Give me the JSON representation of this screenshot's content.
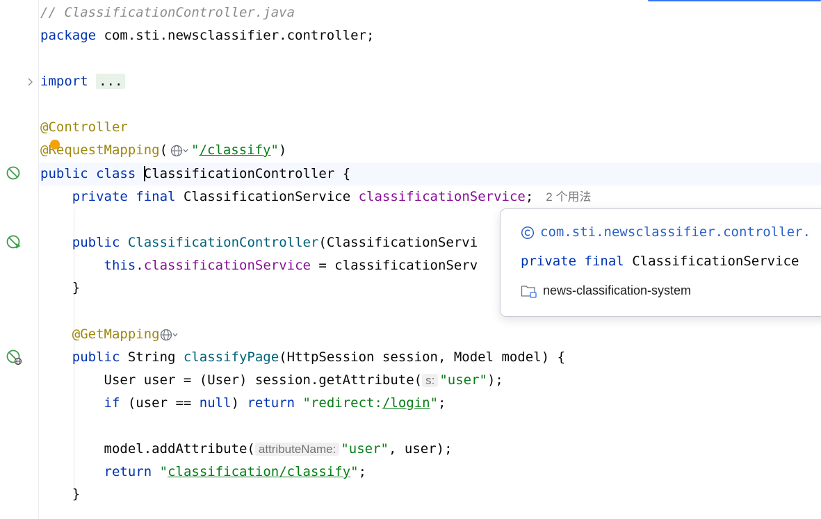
{
  "editor": {
    "lines": {
      "comment": "// ClassificationController.java",
      "package_kw": "package",
      "package_name": " com.sti.newsclassifier.controller;",
      "import_kw": "import",
      "import_fold": "...",
      "controller_ann": "@Controller",
      "reqmap_ann": "@RequestMapping",
      "reqmap_open": "(",
      "reqmap_q1": "\"",
      "reqmap_path": "/classify",
      "reqmap_q2": "\"",
      "reqmap_close": ")",
      "class_public": "public",
      "class_kw": "class",
      "class_name": "ClassificationController",
      "class_brace": " {",
      "field_private": "private",
      "field_final": "final",
      "field_type": " ClassificationService ",
      "field_name": "classificationService",
      "field_semi": ";",
      "field_usages": "2 个用法",
      "ctor_public": "public",
      "ctor_name": "ClassificationController",
      "ctor_rest": "(ClassificationServi",
      "this_kw": "this",
      "this_dot": ".",
      "this_field": "classificationService",
      "this_rest": " = classificationServ",
      "brace1": "}",
      "getmapping_ann": "@GetMapping",
      "method_public": "public",
      "method_type": " String ",
      "method_name": "classifyPage",
      "method_params": "(HttpSession session, Model model) {",
      "user_decl": "User user = (User) session.getAttribute(",
      "hint_s": "s:",
      "user_str": "\"user\"",
      "user_end": ");",
      "if_kw": "if",
      "if_mid": " (user == ",
      "null_kw": "null",
      "if_close": ") ",
      "return_kw": "return",
      "redirect_q1": "\"redirect:",
      "redirect_link": "/login",
      "redirect_q2": "\"",
      "redirect_semi": ";",
      "model_call": "model.addAttribute(",
      "hint_attr": "attributeName:",
      "model_str": "\"user\"",
      "model_end": ", user);",
      "return2_kw": "return",
      "ret_q1": "\"",
      "ret_path": "classification/classify",
      "ret_q2": "\"",
      "ret_semi": ";",
      "brace2": "}"
    }
  },
  "popup": {
    "package_line": "com.sti.newsclassifier.controller.",
    "decl_private": "private",
    "decl_final": "final",
    "decl_type": "ClassificationService",
    "module": "news-classification-system"
  },
  "icons": {
    "gutter_class": "spring-bean-icon",
    "gutter_ctor": "spring-injection-icon",
    "gutter_method": "spring-web-endpoint-icon",
    "fold": "chevron-right-icon",
    "globe": "globe-icon",
    "bulb": "intention-bulb-icon",
    "popup_class": "class-c-icon",
    "popup_module": "folder-icon"
  },
  "colors": {
    "keyword": "#0033b3",
    "annotation": "#9e880d",
    "string": "#067d17",
    "field": "#871094",
    "method": "#00627a",
    "comment": "#8c8c8c",
    "popup_link": "#2a62c9"
  }
}
